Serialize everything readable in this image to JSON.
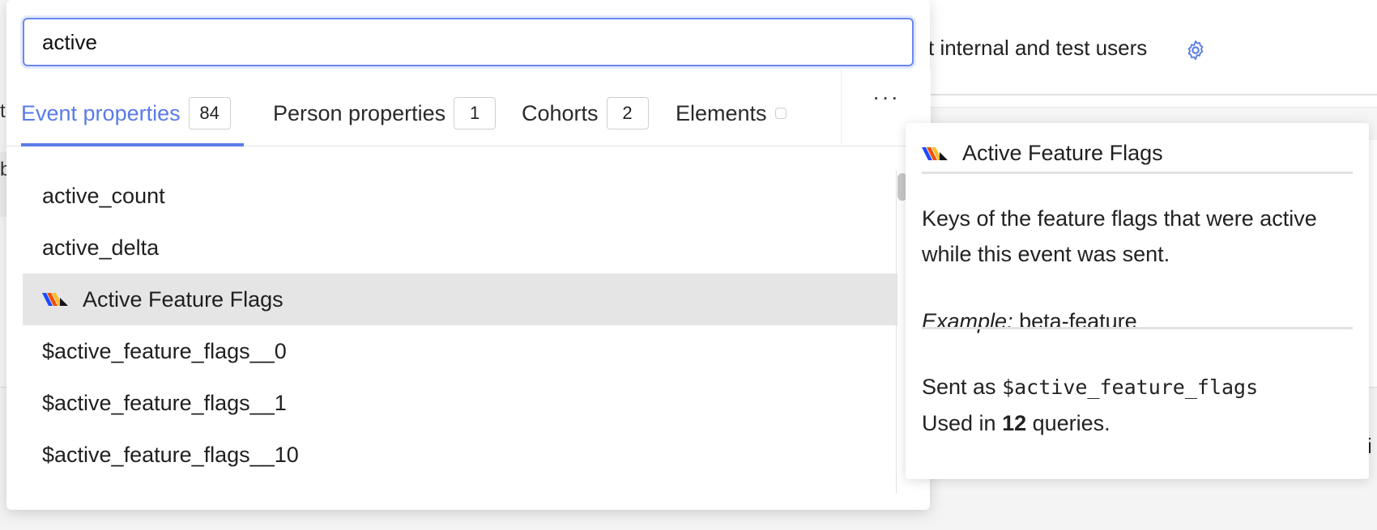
{
  "background": {
    "header_text": "t internal and test users",
    "gear_icon": "gear-icon",
    "left_fragments": [
      "t",
      "b"
    ],
    "right_fragment": "i"
  },
  "search": {
    "value": "active",
    "placeholder": ""
  },
  "tabs": [
    {
      "label": "Event properties",
      "count": "84",
      "active": true
    },
    {
      "label": "Person properties",
      "count": "1",
      "active": false
    },
    {
      "label": "Cohorts",
      "count": "2",
      "active": false
    },
    {
      "label": "Elements",
      "count": "",
      "active": false
    }
  ],
  "more_label": "···",
  "list": {
    "items": [
      {
        "label": "active_count",
        "selected": false,
        "icon": null
      },
      {
        "label": "active_delta",
        "selected": false,
        "icon": null
      },
      {
        "label": "Active Feature Flags",
        "selected": true,
        "icon": "posthog-logo-icon"
      },
      {
        "label": "$active_feature_flags__0",
        "selected": false,
        "icon": null
      },
      {
        "label": "$active_feature_flags__1",
        "selected": false,
        "icon": null
      },
      {
        "label": "$active_feature_flags__10",
        "selected": false,
        "icon": null
      }
    ]
  },
  "info": {
    "title": "Active Feature Flags",
    "description": "Keys of the feature flags that were active while this event was sent.",
    "example_label": "Example:",
    "example_value": "beta-feature",
    "sent_as_prefix": "Sent as",
    "sent_as_value": "$active_feature_flags",
    "used_in_prefix": "Used in",
    "used_in_count": "12",
    "used_in_suffix": "queries."
  },
  "colors": {
    "accent": "#5a7be8",
    "selected_row": "#e5e5e5"
  }
}
